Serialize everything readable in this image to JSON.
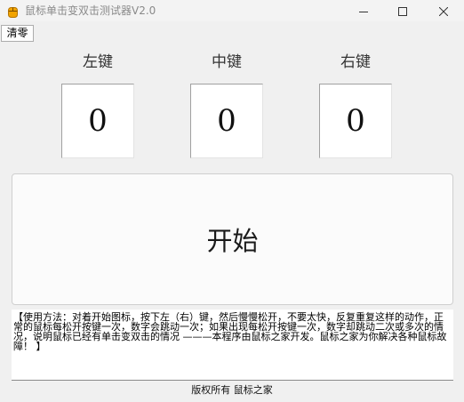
{
  "window": {
    "title": "鼠标单击变双击测试器V2.0"
  },
  "toolbar": {
    "clear_label": "清零"
  },
  "labels": {
    "left": "左键",
    "middle": "中键",
    "right": "右键"
  },
  "counters": {
    "left": "0",
    "middle": "0",
    "right": "0"
  },
  "start_button": {
    "label": "开始"
  },
  "instructions": {
    "text": "【使用方法：对着开始图标，按下左（右）键，然后慢慢松开，不要太快，反复重复这样的动作，正常的鼠标每松开按键一次，数字会跳动一次；如果出现每松开按键一次，数字却跳动二次或多次的情况，说明鼠标已经有单击变双击的情况 ———本程序由鼠标之家开发。鼠标之家为你解决各种鼠标故障！ 】"
  },
  "footer": {
    "text": "版权所有 鼠标之家"
  },
  "colors": {
    "window_bg": "#f0f0f0",
    "box_bg": "#ffffff",
    "icon_accent": "#f2a400"
  }
}
